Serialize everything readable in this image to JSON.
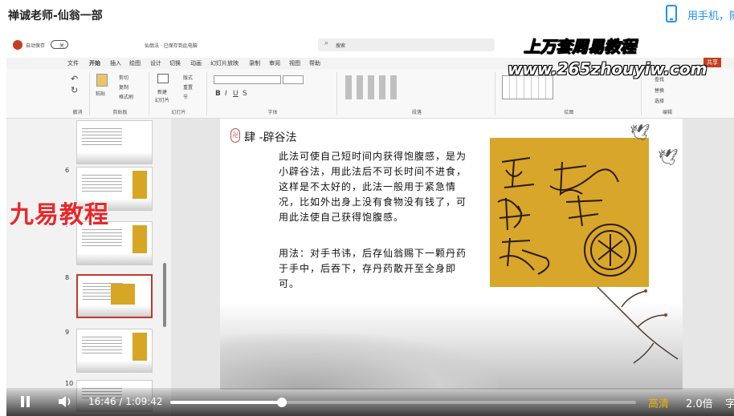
{
  "page": {
    "title": "禅诚老师-仙翁一部",
    "phone_link": "用手机，随"
  },
  "ppt": {
    "autosave_label": "自动保存",
    "autosave_state": "关",
    "filename": "仙翁法 · 已保存到此电脑",
    "search_placeholder": "搜索",
    "tabs": [
      "文件",
      "开始",
      "插入",
      "绘图",
      "设计",
      "切换",
      "动画",
      "幻灯片放映",
      "录制",
      "审阅",
      "视图",
      "帮助"
    ],
    "share": "共享",
    "groups": [
      "撤消",
      "剪贴板",
      "幻灯片",
      "字体",
      "段落",
      "绘图",
      "编辑"
    ],
    "clipboard": {
      "cut": "剪切",
      "copy": "复制",
      "paste": "粘贴",
      "format": "格式刷"
    },
    "slides": {
      "new": "新建",
      "new2": "幻灯片",
      "layout": "版式",
      "reset": "重置",
      "section": "节"
    },
    "edit": {
      "find": "查找",
      "replace": "替换",
      "select": "选择"
    },
    "thumbnails": [
      "6",
      "7",
      "8",
      "9",
      "10"
    ],
    "selected_thumb": "8"
  },
  "slide": {
    "seal": "卍",
    "title": "肆 -辟谷法",
    "body": "此法可使自己短时间内获得饱腹感，是为小辟谷法，用此法后不可长时间不进食，这样是不太好的，此法一般用于紧急情况，比如外出身上没有食物没有钱了，可用此法使自己获得饱腹感。",
    "usage": "用法：对手书讳，后存仙翁赐下一颗丹药于手中，后吞下，存丹药散开至全身即可。"
  },
  "overlay": {
    "title": "上万套周易教程",
    "url": "www.265zhouyiw.com",
    "watermark": "九易教程"
  },
  "player": {
    "time": "16:46  /  1:09:42",
    "progress": 0.24,
    "quality": "高清",
    "speed": "2.0倍",
    "subtitle": "字"
  }
}
